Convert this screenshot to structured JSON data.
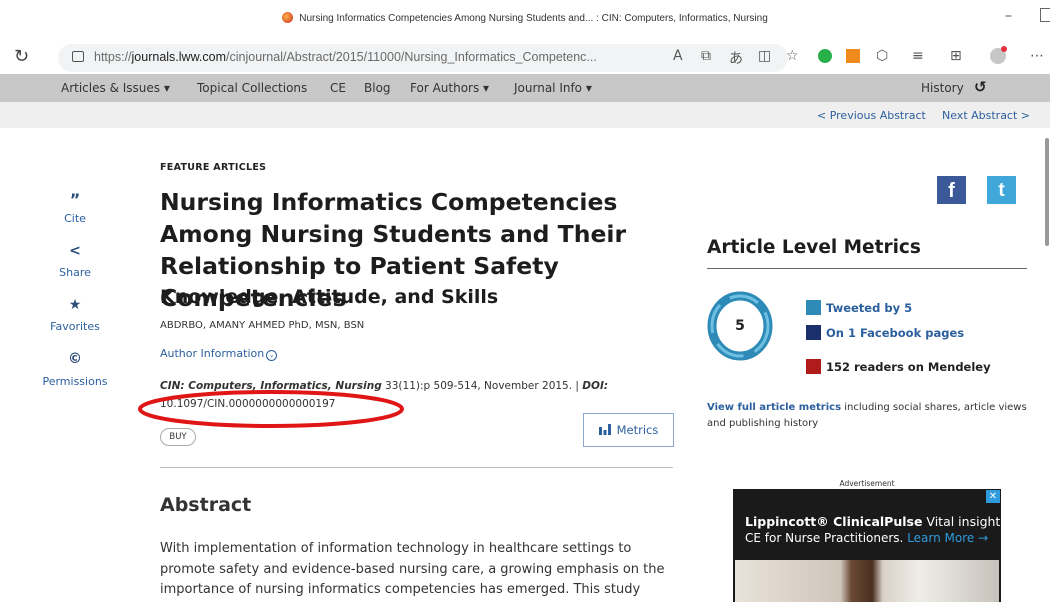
{
  "browser": {
    "tab_title": "Nursing Informatics Competencies Among Nursing Students and... : CIN: Computers, Informatics, Nursing",
    "url_prefix": "https://",
    "url_domain": "journals.lww.com",
    "url_path": "/cinjournal/Abstract/2015/11000/Nursing_Informatics_Competenc...",
    "minimize": "–",
    "toolbar_glyphs": {
      "read_aloud": "A",
      "immersive": "⧉",
      "translate": "あ",
      "split": "◫",
      "favorites": "☆",
      "copilot": "◎",
      "profile": "●",
      "more": "⋯"
    }
  },
  "site_nav": {
    "items": [
      "Articles & Issues ▾",
      "Topical Collections",
      "CE",
      "Blog",
      "For Authors ▾",
      "Journal Info ▾"
    ],
    "history": "History"
  },
  "subnav": {
    "previous": "< Previous Abstract",
    "next": "Next Abstract >"
  },
  "rail": {
    "items": [
      {
        "icon": "”",
        "label": "Cite"
      },
      {
        "icon": "<",
        "label": "Share"
      },
      {
        "icon": "★",
        "label": "Favorites"
      },
      {
        "icon": "©",
        "label": "Permissions"
      }
    ]
  },
  "article": {
    "section": "FEATURE ARTICLES",
    "title": "Nursing Informatics Competencies Among Nursing Students and Their Relationship to Patient Safety Competencies",
    "subtitle": "Knowledge, Attitude, and Skills",
    "authors": "ABDRBO, AMANY AHMED PhD, MSN, BSN",
    "author_info": "Author Information",
    "journal": "CIN: Computers, Informatics, Nursing",
    "citation_details": " 33(11):p 509-514, November 2015. | ",
    "doi_label": "DOI:",
    "doi": "10.1097/CIN.0000000000000197",
    "buy": "BUY",
    "metrics_button": "Metrics",
    "abstract_heading": "Abstract",
    "abstract_text": "With implementation of information technology in healthcare settings to promote safety and evidence-based nursing care, a growing emphasis on the importance of nursing informatics competencies has emerged. This study"
  },
  "metrics": {
    "heading": "Article Level Metrics",
    "score": "5",
    "legend": [
      {
        "label": "Tweeted by 5",
        "color": "#2e8bb8"
      },
      {
        "label": "On 1 Facebook pages",
        "color": "#1a2f6b"
      },
      {
        "label": "152 readers on Mendeley",
        "color": "#b01b1b"
      }
    ],
    "full_link": "View full article metrics",
    "full_rest": " including social shares, article views and publishing history"
  },
  "social": {
    "facebook": "f",
    "twitter": "t"
  },
  "ad": {
    "label": "Advertisement",
    "brand": "Lippincott® ClinicalPulse",
    "tagline": " Vital insights.",
    "line2": "CE for Nurse Practitioners.",
    "learn_more": "Learn More →",
    "close": "✕"
  },
  "colors": {
    "accent_link": "#2b5f9e",
    "nav_bg": "#c8c8c8",
    "annotation": "#e01616"
  }
}
